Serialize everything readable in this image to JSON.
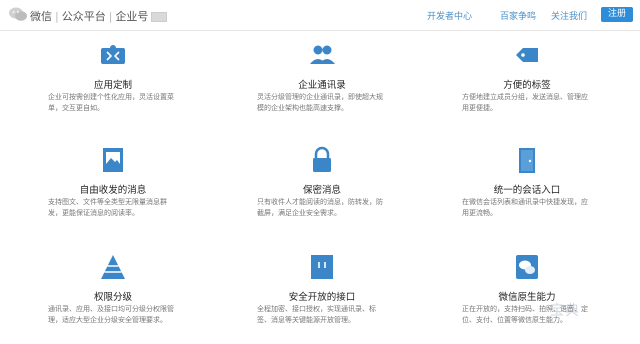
{
  "colors": {
    "accent": "#2d8dd8",
    "icon": "#3b86c8",
    "link": "#4a90c8"
  },
  "header": {
    "logo_icon": "wechat-logo-icon",
    "brand": [
      "微信",
      "公众平台",
      "企业号"
    ],
    "nav": [
      "开发者中心",
      "百家争鸣",
      "关注我们"
    ],
    "register": "注册"
  },
  "features": [
    {
      "icon": "puzzle-icon",
      "title": "应用定制",
      "desc": "企业可按需创建个性化应用，灵活设置菜单，交互更自如。"
    },
    {
      "icon": "contacts-icon",
      "title": "企业通讯录",
      "desc": "灵活分级管理的企业通讯录，即使超大规模的企业架构也能高速支撑。"
    },
    {
      "icon": "tag-icon",
      "title": "方便的标签",
      "desc": "方便地建立成员分组，发送消息、管理应用更便捷。"
    },
    {
      "icon": "image-icon",
      "title": "自由收发的消息",
      "desc": "支持图文、文件等全类型无限量消息群发，更能保证消息的阅读率。"
    },
    {
      "icon": "lock-icon",
      "title": "保密消息",
      "desc": "只有收件人才能阅读的消息，防转发，防截屏，满足企业安全需求。"
    },
    {
      "icon": "door-icon",
      "title": "统一的会话入口",
      "desc": "在微信会话列表和通讯录中快捷发现，应用更流畅。"
    },
    {
      "icon": "pyramid-icon",
      "title": "权限分级",
      "desc": "通讯录、应用、及接口均可分级分权限管理，适应大型企业分级安全管理要求。"
    },
    {
      "icon": "api-icon",
      "title": "安全开放的接口",
      "desc": "全程加密、接口授权，实现通讯录、标签、消息等关键能源开放管理。"
    },
    {
      "icon": "wechat-chat-icon",
      "title": "微信原生能力",
      "desc": "正在开放的，支持扫码、拍照、语音、定位、支付、位置等微信原生能力。"
    }
  ],
  "watermark": "宝典"
}
